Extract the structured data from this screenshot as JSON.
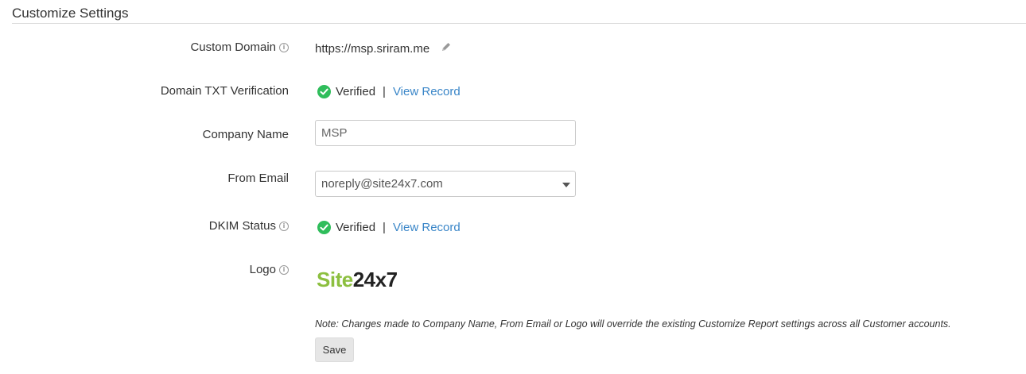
{
  "page": {
    "title": "Customize Settings"
  },
  "custom_domain": {
    "label": "Custom Domain",
    "value": "https://msp.sriram.me"
  },
  "domain_txt": {
    "label": "Domain TXT Verification",
    "status": "Verified",
    "separator": "|",
    "link": "View Record"
  },
  "company_name": {
    "label": "Company Name",
    "value": "MSP"
  },
  "from_email": {
    "label": "From Email",
    "value": "noreply@site24x7.com"
  },
  "dkim": {
    "label": "DKIM Status",
    "status": "Verified",
    "separator": "|",
    "link": "View Record"
  },
  "logo": {
    "label": "Logo",
    "text_a": "Site",
    "text_b": "24x7"
  },
  "note": "Note: Changes made to Company Name, From Email or Logo will override the existing Customize Report settings across all Customer accounts.",
  "save_label": "Save",
  "icons": {
    "info": "info-icon",
    "edit": "pencil-icon",
    "verified": "check-circle-icon",
    "dropdown": "caret-down-icon"
  },
  "colors": {
    "verified": "#2fbd5b",
    "link": "#3a86c8",
    "logo_green": "#8cbf3f"
  }
}
